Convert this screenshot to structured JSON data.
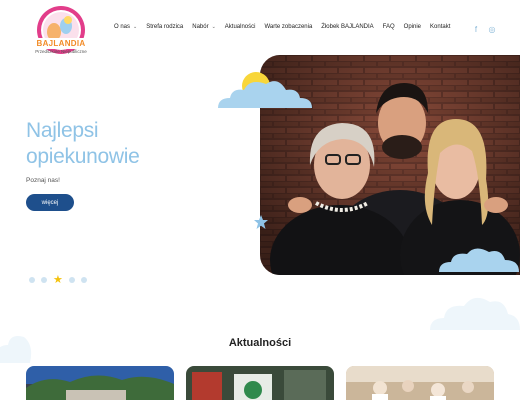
{
  "brand": {
    "logo_text": "BAJLANDIA",
    "subtitle": "Przedszkole Niepubliczne"
  },
  "nav": {
    "items": [
      {
        "label": "O nas",
        "dropdown": true
      },
      {
        "label": "Strefa rodzica",
        "dropdown": false
      },
      {
        "label": "Nabór",
        "dropdown": true
      },
      {
        "label": "Aktualności",
        "dropdown": false
      },
      {
        "label": "Warte zobaczenia",
        "dropdown": false
      },
      {
        "label": "Żłobek BAJLANDIA",
        "dropdown": false
      },
      {
        "label": "FAQ",
        "dropdown": false
      },
      {
        "label": "Opinie",
        "dropdown": false
      },
      {
        "label": "Kontakt",
        "dropdown": false
      }
    ],
    "social": [
      {
        "icon": "facebook-icon",
        "glyph": "f"
      },
      {
        "icon": "instagram-icon",
        "glyph": "◎"
      }
    ]
  },
  "hero": {
    "title_line1": "Najlepsi",
    "title_line2": "opiekunowie",
    "subtitle": "Poznaj nas!",
    "button_label": "więcej"
  },
  "slider": {
    "dot_count": 5,
    "active_index": 2
  },
  "news": {
    "title": "Aktualności"
  },
  "colors": {
    "accent": "#8fc3e6",
    "button": "#1e4f8c",
    "star": "#f4c20d",
    "cloud": "#a9d3ee"
  }
}
